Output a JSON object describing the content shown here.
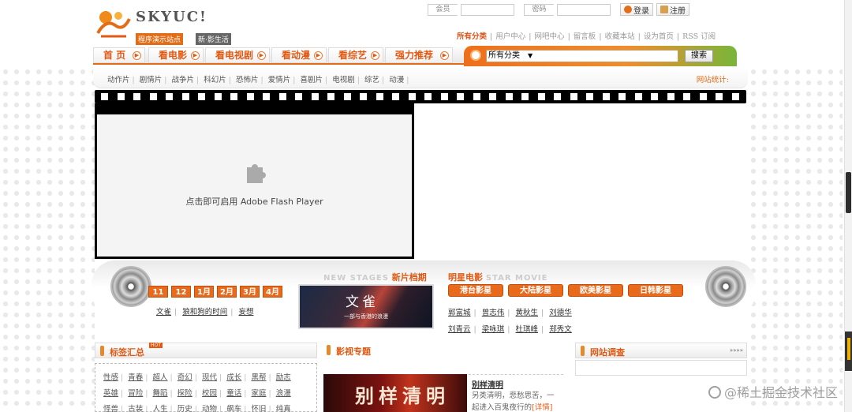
{
  "header": {
    "logo_text": "SKYUC!",
    "logo_sub1": "程序演示站点",
    "logo_sub2": "新·影生活",
    "login": {
      "member_label": "会员",
      "password_label": "密码",
      "login_button": "登录",
      "register_button": "注册"
    },
    "top_links": [
      "所有分类",
      "用户中心",
      "网吧中心",
      "留言板",
      "收藏本站",
      "设为首页",
      "RSS 订阅"
    ]
  },
  "nav": {
    "items": [
      "首 页",
      "看电影",
      "看电视剧",
      "看动漫",
      "看综艺",
      "强力推荐"
    ],
    "search_select": "所有分类",
    "search_button": "搜索"
  },
  "subnav": {
    "links": [
      "动作片",
      "剧情片",
      "战争片",
      "科幻片",
      "恐怖片",
      "爱情片",
      "喜剧片",
      "电视剧",
      "综艺",
      "动漫"
    ],
    "stats": "网站统计:"
  },
  "player": {
    "message": "点击即可启用 Adobe Flash Player"
  },
  "new_stage": {
    "en": "NEW STAGES",
    "cn": "新片档期",
    "months": [
      "11月",
      "12月",
      "1月",
      "2月",
      "3月",
      "4月"
    ],
    "links": [
      "文雀",
      "狼和狗的时间",
      "妄想"
    ],
    "poster_title": "文雀",
    "poster_sub": "一部与香港的浪漫"
  },
  "star_movie": {
    "cn": "明星电影",
    "en": "STAR MOVIE",
    "buttons": [
      "港台影星",
      "大陆影星",
      "欧美影星",
      "日韩影星"
    ],
    "names_row1": [
      "郭富城",
      "曾志伟",
      "黄秋生",
      "刘德华"
    ],
    "names_row2": [
      "刘青云",
      "梁咏琪",
      "杜琪峰",
      "郑秀文"
    ]
  },
  "tags": {
    "title": "标签汇总",
    "badge": "HOT",
    "rows": [
      [
        "性感",
        "青春",
        "超人",
        "奇幻",
        "现代",
        "成长",
        "黑帮",
        "励志"
      ],
      [
        "英雄",
        "冒险",
        "舞蹈",
        "探险",
        "校园",
        "童话",
        "家庭",
        "浪漫"
      ],
      [
        "怪兽",
        "古装",
        "人生",
        "历史",
        "动物",
        "飙车",
        "怀旧",
        "纯真"
      ]
    ]
  },
  "topic": {
    "title": "影视专题",
    "image_text": "别样清明",
    "item_title": "别样清明",
    "item_desc": "另类清明，悲愁思苦，一起进入百鬼夜行的",
    "item_more": "[详情]"
  },
  "survey": {
    "title": "网站调查",
    "more": "»»»»"
  },
  "watermark": "@稀土掘金技术社区"
}
